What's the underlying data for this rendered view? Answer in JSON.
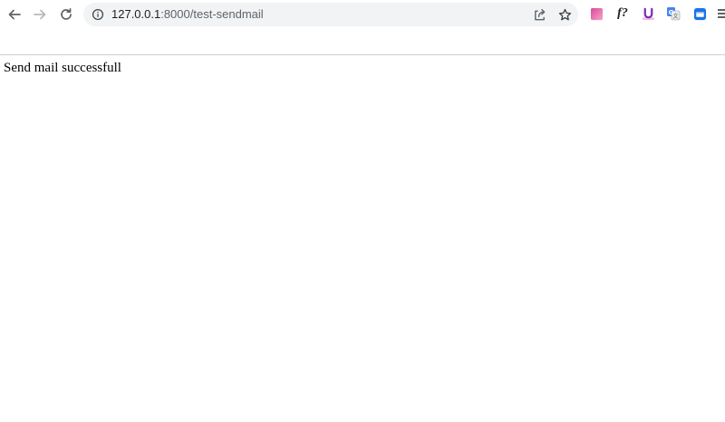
{
  "browser": {
    "url_host": "127.0.0.1",
    "url_path": ":8000/test-sendmail",
    "icons": {
      "back": "arrow-left-icon",
      "forward": "arrow-right-icon",
      "reload": "reload-icon",
      "site_info": "info-circle-icon",
      "share": "share-icon",
      "bookmark": "star-icon"
    },
    "extensions": [
      {
        "name": "gradient-square-extension-icon"
      },
      {
        "name": "font-identifier-extension-icon",
        "label": "f?"
      },
      {
        "name": "u-extension-icon",
        "label": "U"
      },
      {
        "name": "google-translate-extension-icon"
      },
      {
        "name": "window-extension-icon"
      }
    ]
  },
  "page": {
    "message": "Send mail successfull"
  },
  "colors": {
    "omnibox_bg": "#f1f3f4",
    "text": "#000000",
    "icon": "#5f6368"
  }
}
